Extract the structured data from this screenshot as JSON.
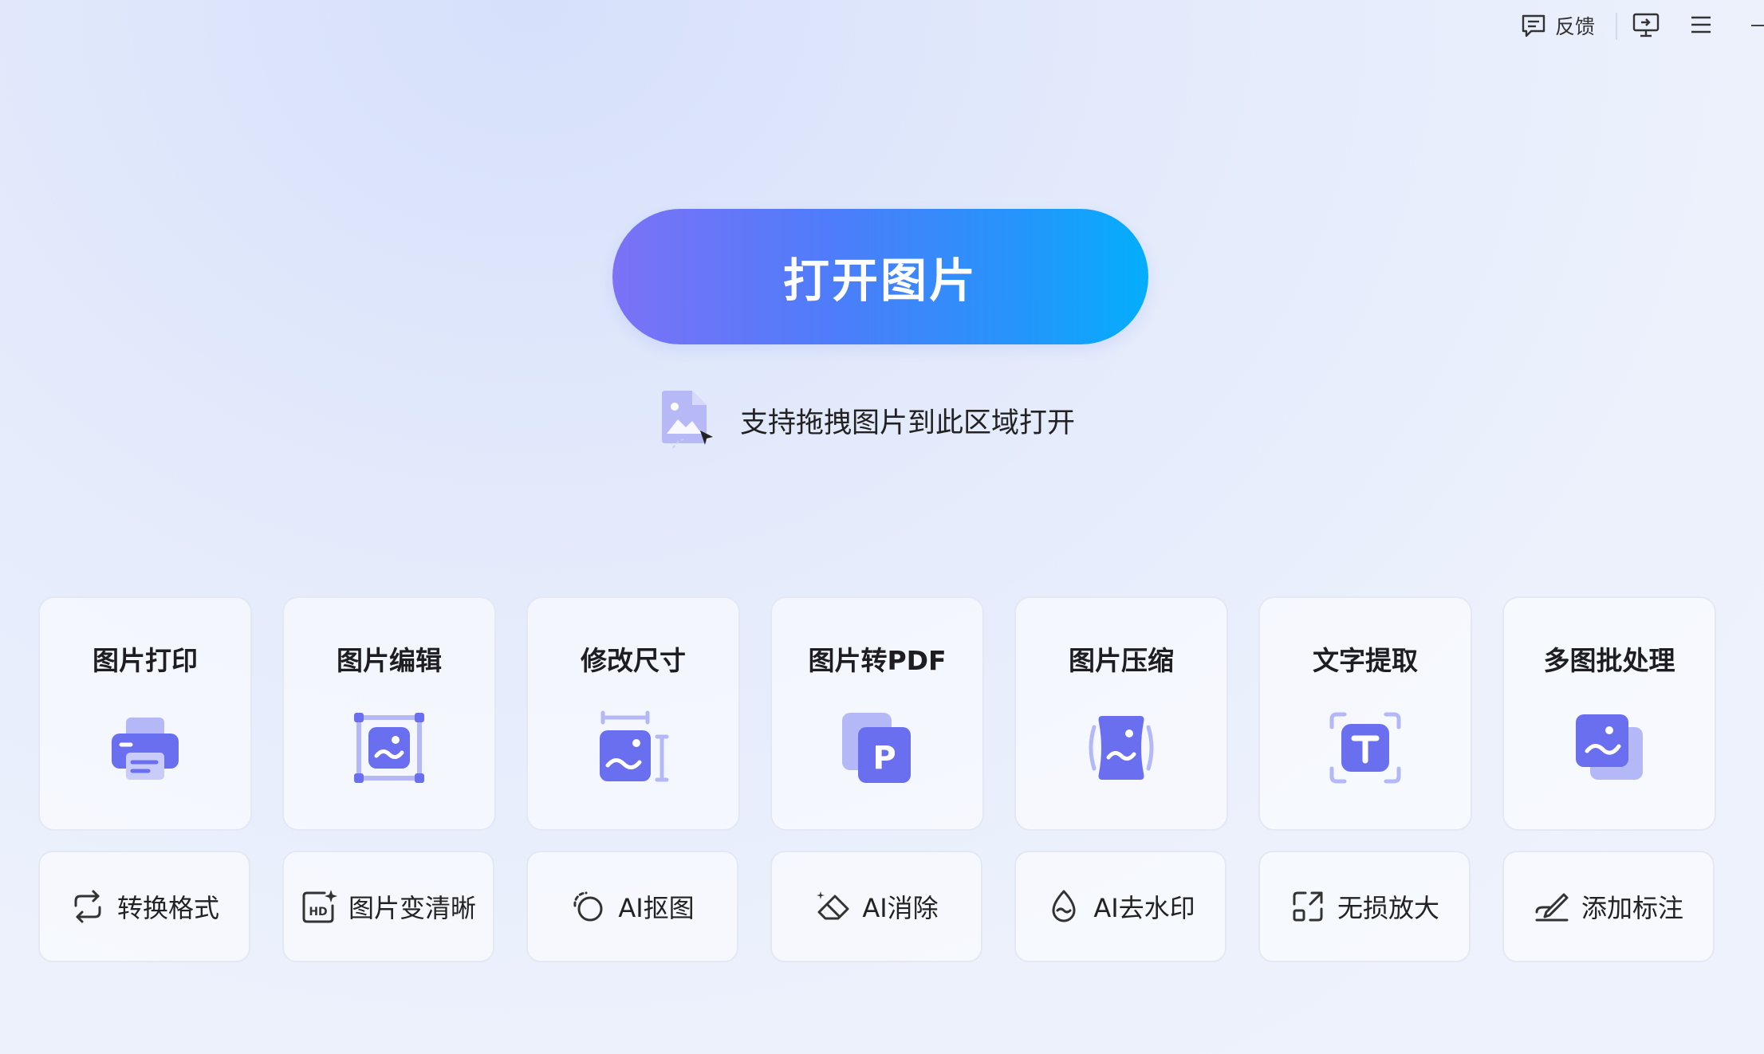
{
  "topbar": {
    "feedback_label": "反馈"
  },
  "hero": {
    "open_button_label": "打开图片",
    "drag_hint": "支持拖拽图片到此区域打开"
  },
  "cards": [
    {
      "label": "图片打印",
      "icon": "printer-icon"
    },
    {
      "label": "图片编辑",
      "icon": "image-edit-icon"
    },
    {
      "label": "修改尺寸",
      "icon": "resize-icon"
    },
    {
      "label": "图片转PDF",
      "icon": "pdf-icon"
    },
    {
      "label": "图片压缩",
      "icon": "compress-icon"
    },
    {
      "label": "文字提取",
      "icon": "text-extract-icon"
    },
    {
      "label": "多图批处理",
      "icon": "batch-icon"
    }
  ],
  "tools": [
    {
      "label": "转换格式",
      "icon": "convert-icon"
    },
    {
      "label": "图片变清晰",
      "icon": "hd-icon"
    },
    {
      "label": "AI抠图",
      "icon": "cutout-icon"
    },
    {
      "label": "AI消除",
      "icon": "eraser-icon"
    },
    {
      "label": "AI去水印",
      "icon": "watermark-icon"
    },
    {
      "label": "无损放大",
      "icon": "upscale-icon"
    },
    {
      "label": "添加标注",
      "icon": "annotate-icon"
    }
  ],
  "colors": {
    "accent": "#6a6ff0",
    "accent_light": "#a8acf7",
    "button_gradient_start": "#7c72f6",
    "button_gradient_end": "#04aefc"
  }
}
